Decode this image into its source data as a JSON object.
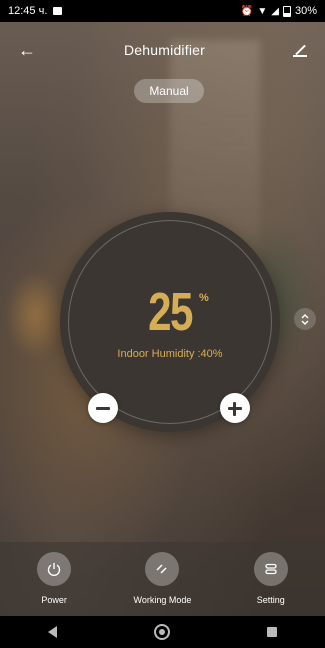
{
  "status_bar": {
    "time": "12:45 ч.",
    "battery": "30%",
    "icons": [
      "image-icon",
      "alarm-icon",
      "wifi-icon",
      "signal-icon",
      "battery-icon"
    ]
  },
  "header": {
    "title": "Dehumidifier",
    "back_icon": "arrow-left-icon",
    "edit_icon": "pencil-icon"
  },
  "mode": {
    "label": "Manual"
  },
  "dial": {
    "value": "25",
    "unit": "%",
    "indoor_text": "Indoor Humidity :40%",
    "accent_color": "#d6ad57",
    "dial_color": "#3b3631"
  },
  "actions": [
    {
      "label": "Power",
      "icon": "power-icon"
    },
    {
      "label": "Working Mode",
      "icon": "mode-slashes-icon"
    },
    {
      "label": "Setting",
      "icon": "settings-toggle-icon"
    }
  ],
  "navbar": {
    "icons": [
      "back-triangle-icon",
      "home-circle-icon",
      "recent-square-icon"
    ]
  }
}
